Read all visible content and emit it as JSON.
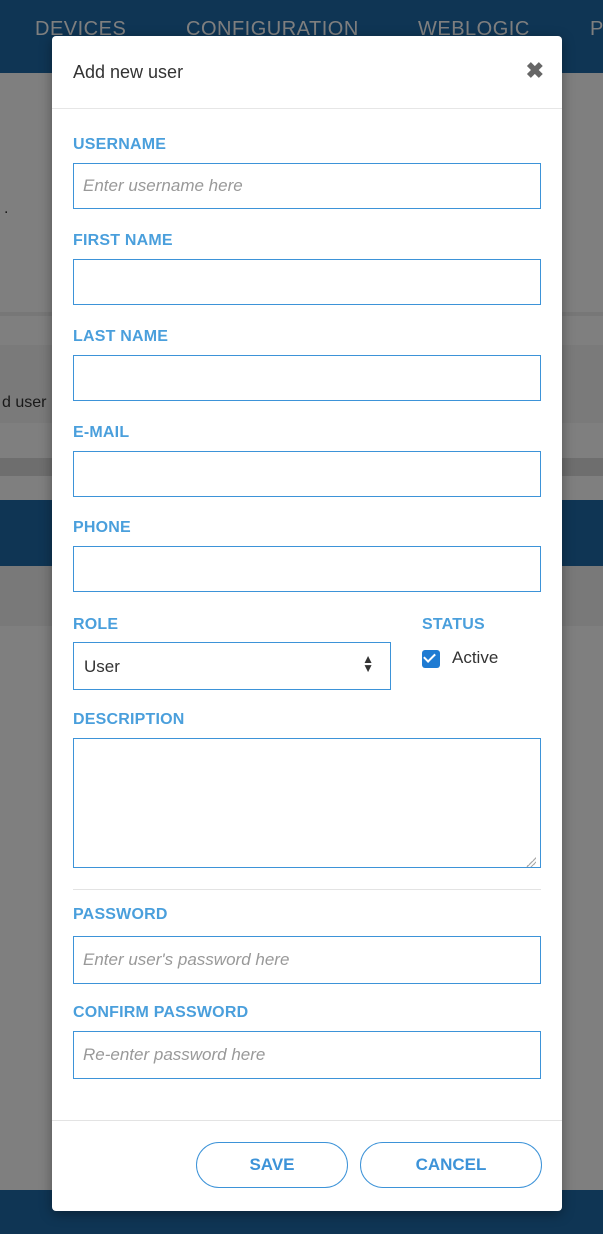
{
  "background": {
    "nav_items": [
      "DEVICES",
      "CONFIGURATION",
      "WEBLOGIC",
      "P"
    ],
    "text_fragments": [
      ".",
      "d user"
    ]
  },
  "modal": {
    "title": "Add new user",
    "close_icon": "close-icon"
  },
  "form": {
    "username": {
      "label": "USERNAME",
      "value": "",
      "placeholder": "Enter username here"
    },
    "first_name": {
      "label": "FIRST NAME",
      "value": "",
      "placeholder": ""
    },
    "last_name": {
      "label": "LAST NAME",
      "value": "",
      "placeholder": ""
    },
    "email": {
      "label": "E-MAIL",
      "value": "",
      "placeholder": ""
    },
    "phone": {
      "label": "PHONE",
      "value": "",
      "placeholder": ""
    },
    "role": {
      "label": "ROLE",
      "selected": "User",
      "icon": "updown-icon"
    },
    "status": {
      "label": "STATUS",
      "checkbox_label": "Active",
      "checked": true
    },
    "description": {
      "label": "DESCRIPTION",
      "value": ""
    },
    "password": {
      "label": "PASSWORD",
      "value": "",
      "placeholder": "Enter user's password here"
    },
    "confirm_password": {
      "label": "CONFIRM PASSWORD",
      "value": "",
      "placeholder": "Re-enter password here"
    }
  },
  "buttons": {
    "save": "SAVE",
    "cancel": "CANCEL"
  },
  "colors": {
    "accent": "#3d93d8",
    "label": "#4a9fdc",
    "nav": "#1f6aa8",
    "checkbox": "#1f7bd2"
  }
}
